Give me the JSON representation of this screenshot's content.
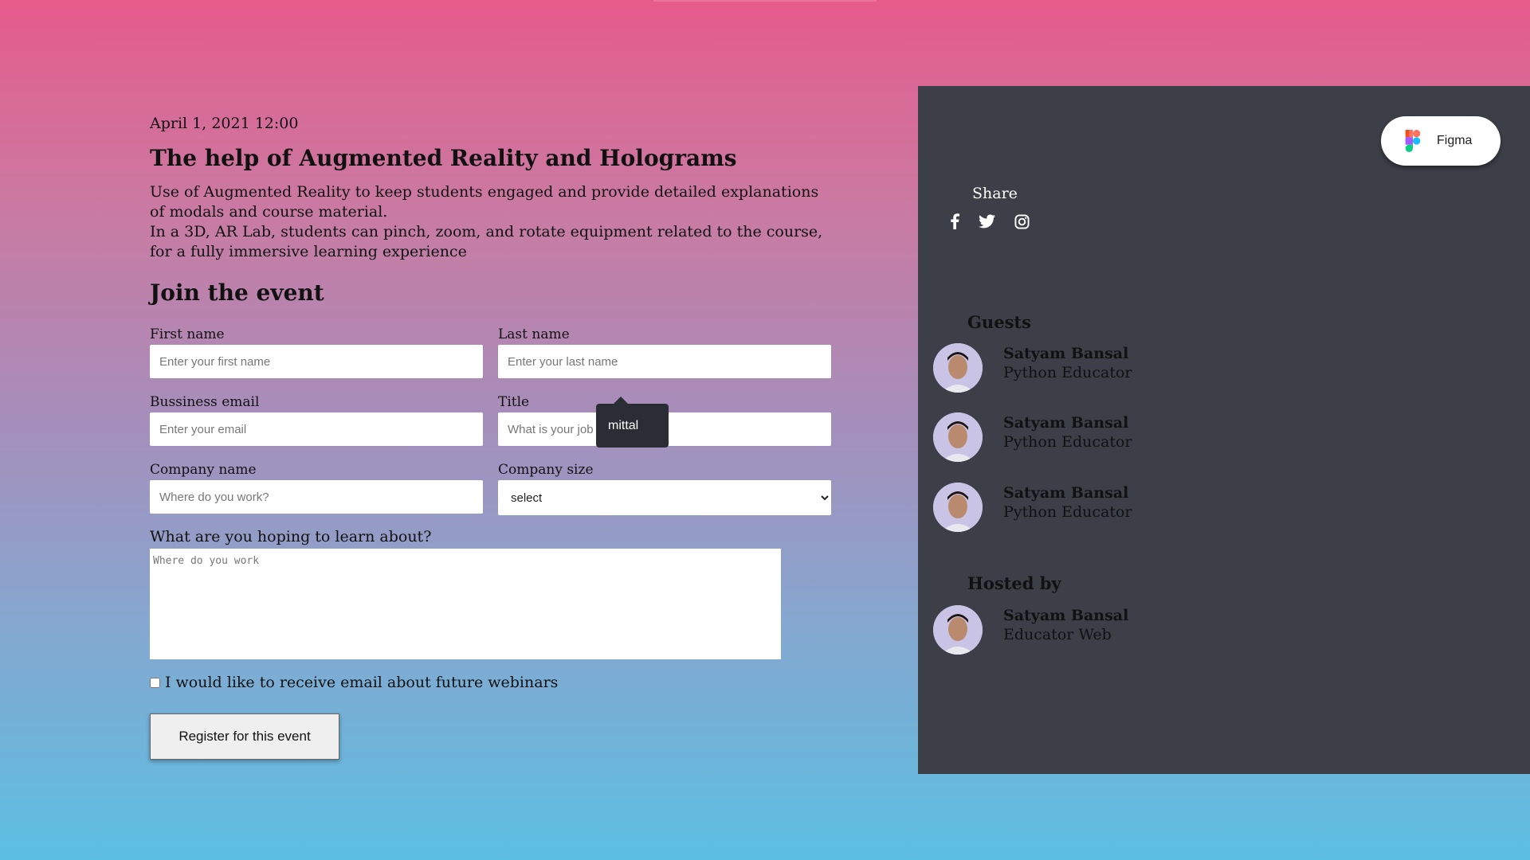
{
  "event": {
    "date": "April 1, 2021 12:00",
    "title": "The help of Augmented Reality and Holograms",
    "description_1": "Use of Augmented Reality to keep students engaged and provide detailed explanations of modals and course material.",
    "description_2": "In a 3D, AR Lab, students can pinch, zoom, and rotate equipment related to the course, for a fully immersive learning experience"
  },
  "form": {
    "heading": "Join the event",
    "first_name": {
      "label": "First name",
      "placeholder": "Enter your first name",
      "value": ""
    },
    "last_name": {
      "label": "Last name",
      "placeholder": "Enter your last name",
      "value": ""
    },
    "email": {
      "label": "Bussiness email",
      "placeholder": "Enter your email",
      "value": ""
    },
    "title": {
      "label": "Title",
      "placeholder": "What is your job title?",
      "value": ""
    },
    "company_name": {
      "label": "Company name",
      "placeholder": "Where do you work?",
      "value": ""
    },
    "company_size": {
      "label": "Company size",
      "selected": "select"
    },
    "learn": {
      "label": "What are you hoping to learn about?",
      "placeholder": "Where do you work"
    },
    "newsletter_label": "I would like to receive email about future webinars",
    "newsletter_checked": false,
    "submit_label": "Register for this event"
  },
  "autocomplete_tooltip": {
    "text": "mittal"
  },
  "figma_button": {
    "label": "Figma"
  },
  "share": {
    "label": "Share",
    "icons": [
      "facebook-icon",
      "twitter-icon",
      "instagram-icon"
    ]
  },
  "guests": {
    "heading": "Guests",
    "people": [
      {
        "name": "Satyam Bansal",
        "role": "Python Educator"
      },
      {
        "name": "Satyam Bansal",
        "role": "Python Educator"
      },
      {
        "name": "Satyam Bansal",
        "role": "Python Educator"
      }
    ]
  },
  "host": {
    "heading": "Hosted by",
    "name": "Satyam Bansal",
    "role": "Educator Web"
  },
  "colors": {
    "gradient_top": "#e65b8a",
    "gradient_bottom": "#5cbfe3",
    "panel": "#3c3f48"
  }
}
